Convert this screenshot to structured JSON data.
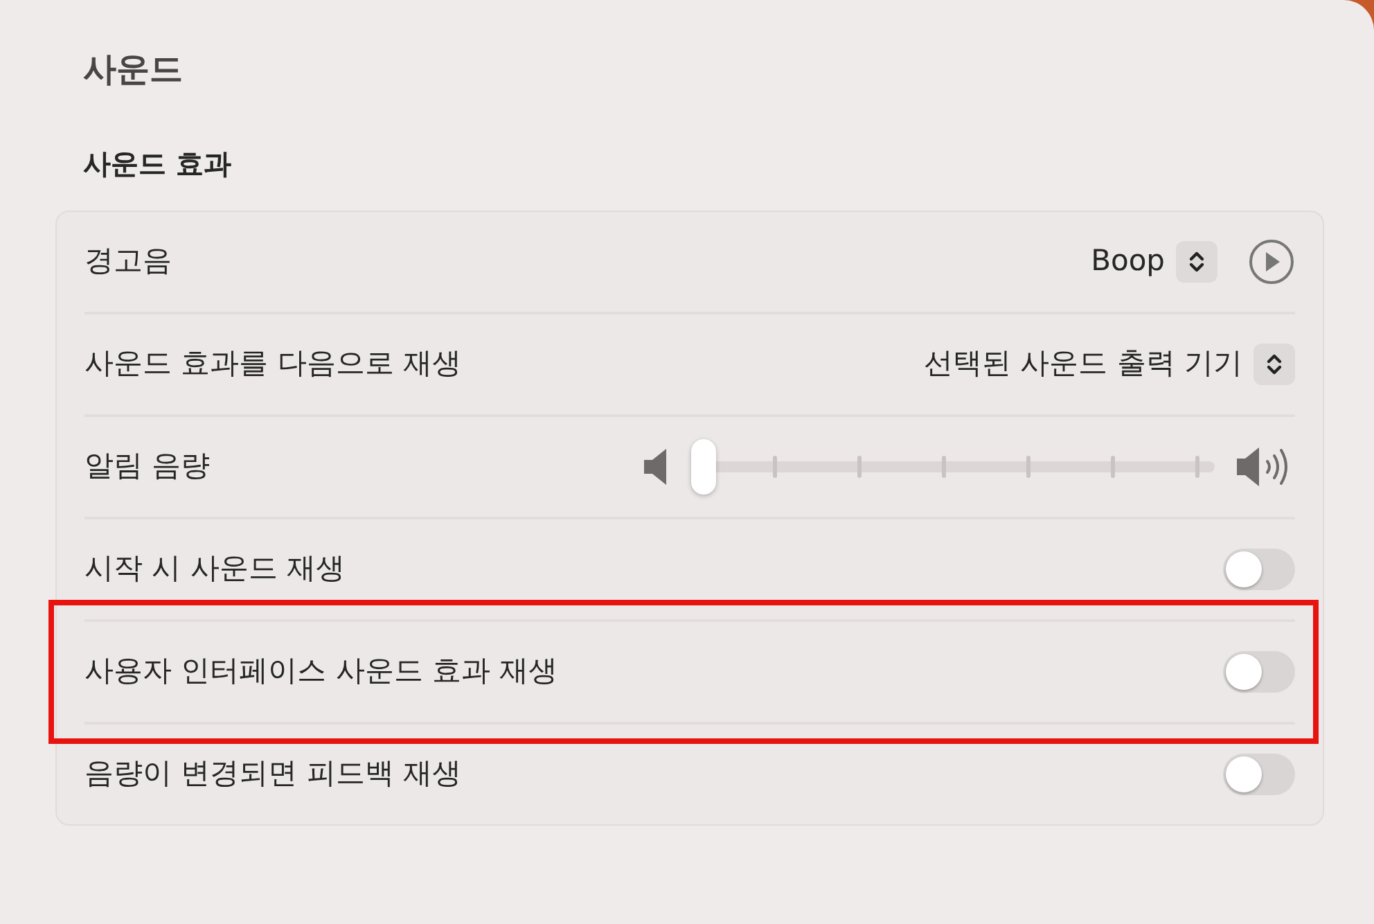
{
  "window": {
    "title": "사운드"
  },
  "section": {
    "title": "사운드 효과"
  },
  "rows": [
    {
      "kind": "playpopup",
      "label": "경고음",
      "value": "Boop",
      "highlighted": false
    },
    {
      "kind": "popup",
      "label": "사운드 효과를 다음으로 재생",
      "value": "선택된 사운드 출력 기기",
      "highlighted": false
    },
    {
      "kind": "slider",
      "label": "알림 음량",
      "level": 0,
      "highlighted": false
    },
    {
      "kind": "toggle",
      "label": "시작 시 사운드 재생",
      "on": false,
      "highlighted": false
    },
    {
      "kind": "toggle",
      "label": "사용자 인터페이스 사운드 효과 재생",
      "on": false,
      "highlighted": true
    },
    {
      "kind": "toggle",
      "label": "음량이 변경되면 피드백 재생",
      "on": false,
      "highlighted": false
    }
  ]
}
